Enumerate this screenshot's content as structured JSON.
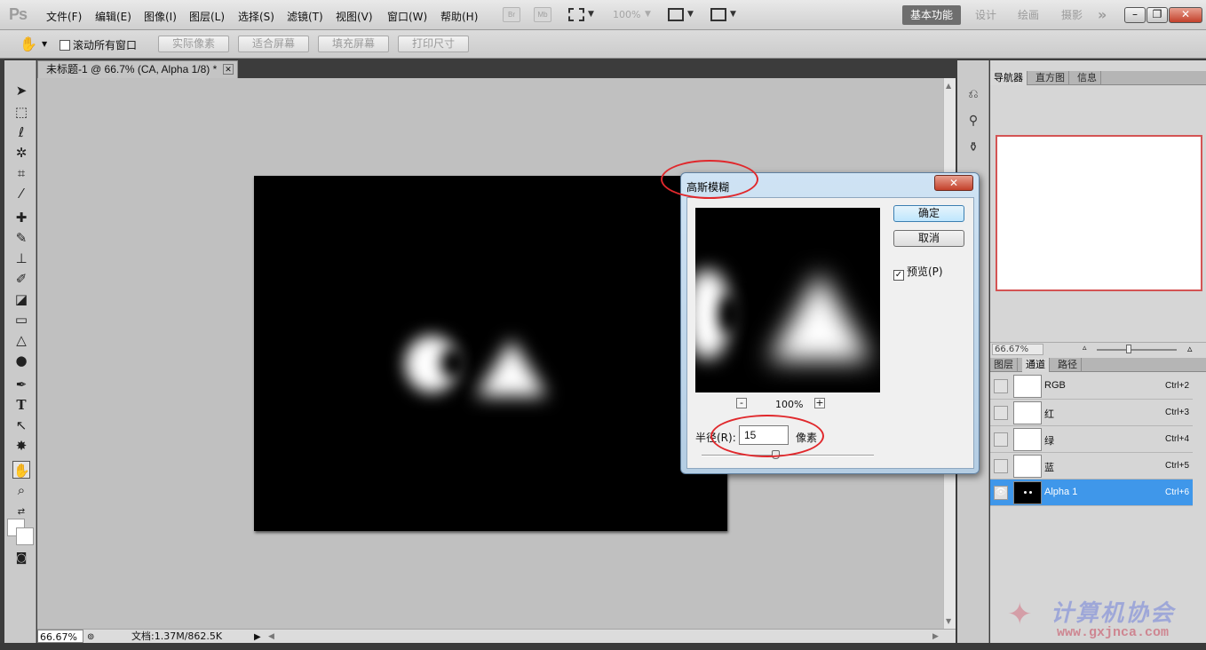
{
  "menubar": {
    "logo": "Ps",
    "items": [
      "文件(F)",
      "编辑(E)",
      "图像(I)",
      "图层(L)",
      "选择(S)",
      "滤镜(T)",
      "视图(V)",
      "窗口(W)",
      "帮助(H)"
    ],
    "bridge_label": "Br",
    "minibridge_label": "Mb",
    "zoom_value": "100%",
    "workspaces": [
      "基本功能",
      "设计",
      "绘画",
      "摄影"
    ],
    "more": "»"
  },
  "options": {
    "scroll_all_label": "滚动所有窗口",
    "buttons": [
      "实际像素",
      "适合屏幕",
      "填充屏幕",
      "打印尺寸"
    ]
  },
  "document": {
    "tab_title": "未标题-1 @ 66.7% (CA, Alpha 1/8) *",
    "zoom": "66.67%",
    "info": "文档:1.37M/862.5K"
  },
  "dialog": {
    "title": "高斯模糊",
    "ok": "确定",
    "cancel": "取消",
    "preview_label": "预览(P)",
    "preview_checked": true,
    "zoom_minus": "-",
    "zoom_plus": "+",
    "zoom": "100%",
    "radius_label": "半径(R):",
    "radius_value": "15",
    "radius_unit": "像素"
  },
  "panels": {
    "top_tabs": [
      "导航器",
      "直方图",
      "信息"
    ],
    "nav_zoom": "66.67%",
    "bottom_tabs": [
      "图层",
      "通道",
      "路径"
    ],
    "channels": [
      {
        "name": "RGB",
        "shortcut": "Ctrl+2"
      },
      {
        "name": "红",
        "shortcut": "Ctrl+3"
      },
      {
        "name": "绿",
        "shortcut": "Ctrl+4"
      },
      {
        "name": "蓝",
        "shortcut": "Ctrl+5"
      },
      {
        "name": "Alpha 1",
        "shortcut": "Ctrl+6",
        "selected": true
      }
    ]
  },
  "watermark": {
    "text": "计算机协会",
    "url": "www.gxjnca.com"
  },
  "colors": {
    "accent": "#3f97ea",
    "annotation": "#e0282c"
  }
}
